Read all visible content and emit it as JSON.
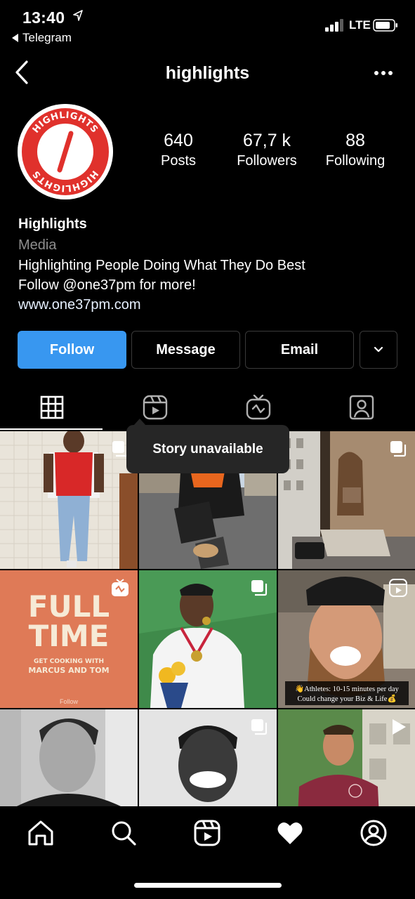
{
  "status_bar": {
    "time": "13:40",
    "back_app": "Telegram",
    "network": "LTE"
  },
  "header": {
    "title": "highlights"
  },
  "profile": {
    "avatar_logo_text": "HIGHLIGHTS",
    "stats": [
      {
        "value": "640",
        "label": "Posts"
      },
      {
        "value": "67,7 k",
        "label": "Followers"
      },
      {
        "value": "88",
        "label": "Following"
      }
    ],
    "name": "Highlights",
    "category": "Media",
    "bio_lines": [
      "Highlighting People Doing What They Do Best",
      "Follow @one37pm for more!"
    ],
    "website": "www.one37pm.com"
  },
  "actions": {
    "follow": "Follow",
    "message": "Message",
    "email": "Email"
  },
  "tabs": [
    "grid-icon",
    "reels-icon",
    "igtv-icon",
    "tagged-icon"
  ],
  "tooltip": "Story unavailable",
  "grid": {
    "posts": [
      {
        "name": "post-supreme-jersey",
        "badge": "multi"
      },
      {
        "name": "post-tying-shoes",
        "badge": "none"
      },
      {
        "name": "post-woman-window",
        "badge": "multi"
      },
      {
        "name": "post-full-time",
        "badge": "igtv",
        "title_1": "FULL",
        "title_2": "TIME",
        "subtitle_1": "GET COOKING WITH",
        "subtitle_2": "MARCUS AND TOM",
        "footer": "Follow"
      },
      {
        "name": "post-medalist",
        "badge": "multi"
      },
      {
        "name": "post-bearded-man",
        "badge": "reels",
        "caption_1": "👋Athletes: 10-15 minutes per day",
        "caption_2": "Could change your Biz & Life💰"
      },
      {
        "name": "post-bw-portrait-1",
        "badge": "none"
      },
      {
        "name": "post-bw-portrait-2",
        "badge": "multi"
      },
      {
        "name": "post-man-outdoors",
        "badge": "video"
      }
    ]
  },
  "bottom_nav": [
    "home-icon",
    "search-icon",
    "reels-icon",
    "heart-icon",
    "profile-icon"
  ],
  "colors": {
    "follow_button": "#3897f0",
    "background": "#000000",
    "logo_red": "#e0312c",
    "full_time_bg": "#df7a57",
    "muted_text": "#8e8e8e"
  }
}
